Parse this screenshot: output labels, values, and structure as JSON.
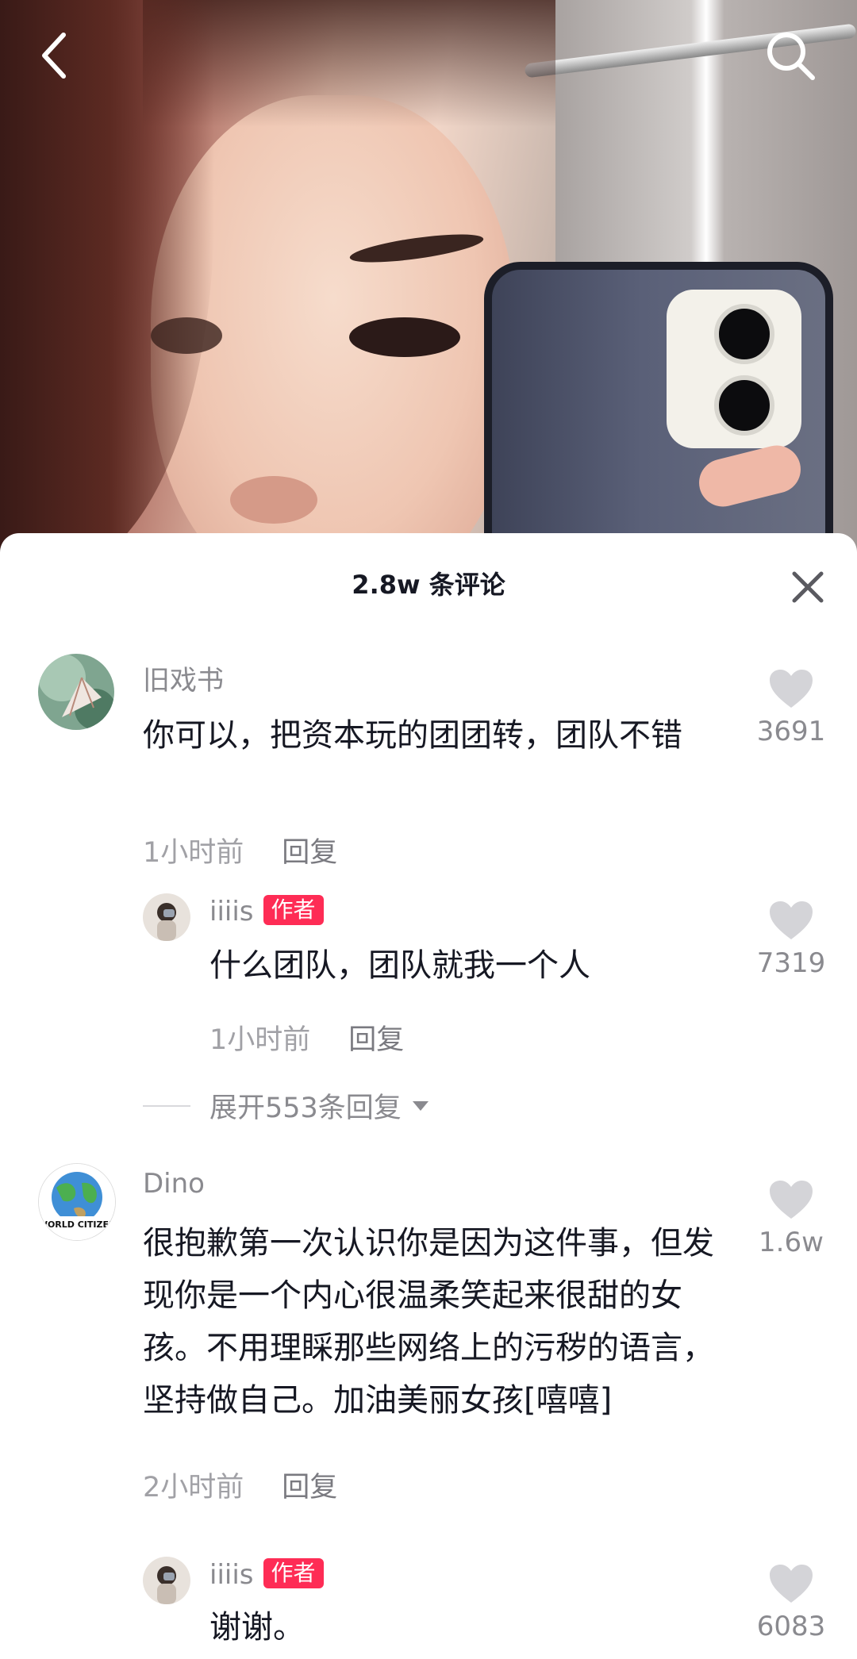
{
  "nav": {
    "back_icon": "chevron-left-icon",
    "search_icon": "search-icon"
  },
  "sheet": {
    "title": "2.8w 条评论",
    "close_icon": "close-icon"
  },
  "comments": [
    {
      "username": "旧戏书",
      "text": "你可以，把资本玩的团团转，团队不错",
      "time": "1小时前",
      "reply_label": "回复",
      "likes": "3691",
      "replies": [
        {
          "username": "iiiis",
          "badge": "作者",
          "text": "什么团队，团队就我一个人",
          "time": "1小时前",
          "reply_label": "回复",
          "likes": "7319"
        }
      ],
      "expand_label": "展开553条回复"
    },
    {
      "username": "Dino",
      "avatar_text": "WORLD CITIZEN",
      "text": "很抱歉第一次认识你是因为这件事，但发现你是一个内心很温柔笑起来很甜的女孩。不用理睬那些网络上的污秽的语言，坚持做自己。加油美丽女孩[嘻嘻]",
      "time": "2小时前",
      "reply_label": "回复",
      "likes": "1.6w",
      "replies": [
        {
          "username": "iiiis",
          "badge": "作者",
          "text": "谢谢。",
          "likes": "6083"
        }
      ]
    }
  ],
  "colors": {
    "accent": "#fe2c55",
    "text": "#161823",
    "muted": "#8a8a8f",
    "heart": "#d4d4d8"
  }
}
